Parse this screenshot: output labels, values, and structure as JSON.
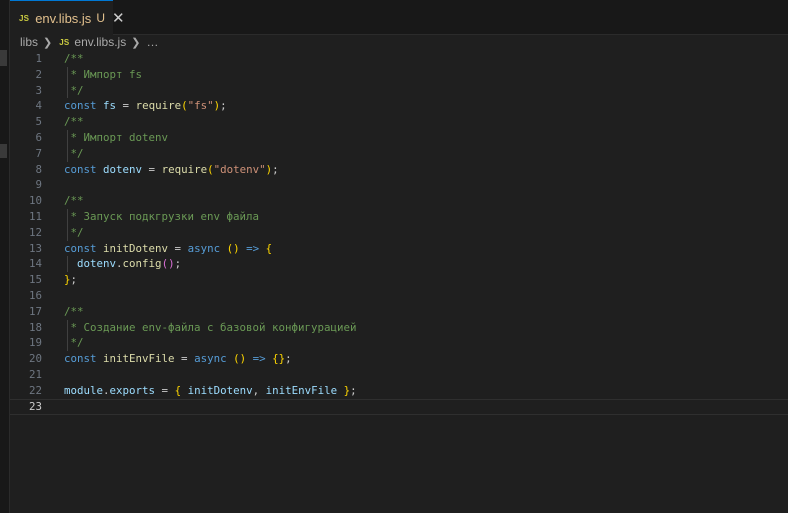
{
  "tab": {
    "icon_text": "JS",
    "filename": "env.libs.js",
    "status": "U",
    "close_glyph": "✕"
  },
  "breadcrumb": {
    "folder": "libs",
    "icon_text": "JS",
    "file": "env.libs.js",
    "more": "…"
  },
  "editor": {
    "active_line": 23,
    "lines": [
      {
        "n": "1",
        "tokens": [
          [
            "c",
            "/**"
          ]
        ]
      },
      {
        "n": "2",
        "tokens": [
          [
            "c",
            " * Импорт fs"
          ]
        ]
      },
      {
        "n": "3",
        "tokens": [
          [
            "c",
            " */"
          ]
        ]
      },
      {
        "n": "4",
        "tokens": [
          [
            "k",
            "const"
          ],
          [
            "p",
            " "
          ],
          [
            "v",
            "fs"
          ],
          [
            "p",
            " = "
          ],
          [
            "f",
            "require"
          ],
          [
            "b1",
            "("
          ],
          [
            "s",
            "\"fs\""
          ],
          [
            "b1",
            ")"
          ],
          [
            "p",
            ";"
          ]
        ]
      },
      {
        "n": "5",
        "tokens": [
          [
            "c",
            "/**"
          ]
        ]
      },
      {
        "n": "6",
        "tokens": [
          [
            "c",
            " * Импорт dotenv"
          ]
        ]
      },
      {
        "n": "7",
        "tokens": [
          [
            "c",
            " */"
          ]
        ]
      },
      {
        "n": "8",
        "tokens": [
          [
            "k",
            "const"
          ],
          [
            "p",
            " "
          ],
          [
            "v",
            "dotenv"
          ],
          [
            "p",
            " = "
          ],
          [
            "f",
            "require"
          ],
          [
            "b1",
            "("
          ],
          [
            "s",
            "\"dotenv\""
          ],
          [
            "b1",
            ")"
          ],
          [
            "p",
            ";"
          ]
        ]
      },
      {
        "n": "9",
        "tokens": []
      },
      {
        "n": "10",
        "tokens": [
          [
            "c",
            "/**"
          ]
        ]
      },
      {
        "n": "11",
        "tokens": [
          [
            "c",
            " * Запуск подкгрузки env файла"
          ]
        ]
      },
      {
        "n": "12",
        "tokens": [
          [
            "c",
            " */"
          ]
        ]
      },
      {
        "n": "13",
        "tokens": [
          [
            "k",
            "const"
          ],
          [
            "p",
            " "
          ],
          [
            "f",
            "initDotenv"
          ],
          [
            "p",
            " = "
          ],
          [
            "k",
            "async"
          ],
          [
            "p",
            " "
          ],
          [
            "b1",
            "()"
          ],
          [
            "p",
            " "
          ],
          [
            "k",
            "=>"
          ],
          [
            "p",
            " "
          ],
          [
            "b1",
            "{"
          ]
        ]
      },
      {
        "n": "14",
        "tokens": [
          [
            "p",
            "  "
          ],
          [
            "v",
            "dotenv"
          ],
          [
            "p",
            "."
          ],
          [
            "f",
            "config"
          ],
          [
            "b2",
            "()"
          ],
          [
            "p",
            ";"
          ]
        ]
      },
      {
        "n": "15",
        "tokens": [
          [
            "b1",
            "}"
          ],
          [
            "p",
            ";"
          ]
        ]
      },
      {
        "n": "16",
        "tokens": []
      },
      {
        "n": "17",
        "tokens": [
          [
            "c",
            "/**"
          ]
        ]
      },
      {
        "n": "18",
        "tokens": [
          [
            "c",
            " * Создание env-файла с базовой конфигурацией"
          ]
        ]
      },
      {
        "n": "19",
        "tokens": [
          [
            "c",
            " */"
          ]
        ]
      },
      {
        "n": "20",
        "tokens": [
          [
            "k",
            "const"
          ],
          [
            "p",
            " "
          ],
          [
            "f",
            "initEnvFile"
          ],
          [
            "p",
            " = "
          ],
          [
            "k",
            "async"
          ],
          [
            "p",
            " "
          ],
          [
            "b1",
            "()"
          ],
          [
            "p",
            " "
          ],
          [
            "k",
            "=>"
          ],
          [
            "p",
            " "
          ],
          [
            "b1",
            "{}"
          ],
          [
            "p",
            ";"
          ]
        ]
      },
      {
        "n": "21",
        "tokens": []
      },
      {
        "n": "22",
        "tokens": [
          [
            "v",
            "module"
          ],
          [
            "p",
            "."
          ],
          [
            "v",
            "exports"
          ],
          [
            "p",
            " = "
          ],
          [
            "b1",
            "{"
          ],
          [
            "p",
            " "
          ],
          [
            "v",
            "initDotenv"
          ],
          [
            "p",
            ", "
          ],
          [
            "v",
            "initEnvFile"
          ],
          [
            "p",
            " "
          ],
          [
            "b1",
            "}"
          ],
          [
            "p",
            ";"
          ]
        ]
      },
      {
        "n": "23",
        "tokens": []
      }
    ]
  }
}
